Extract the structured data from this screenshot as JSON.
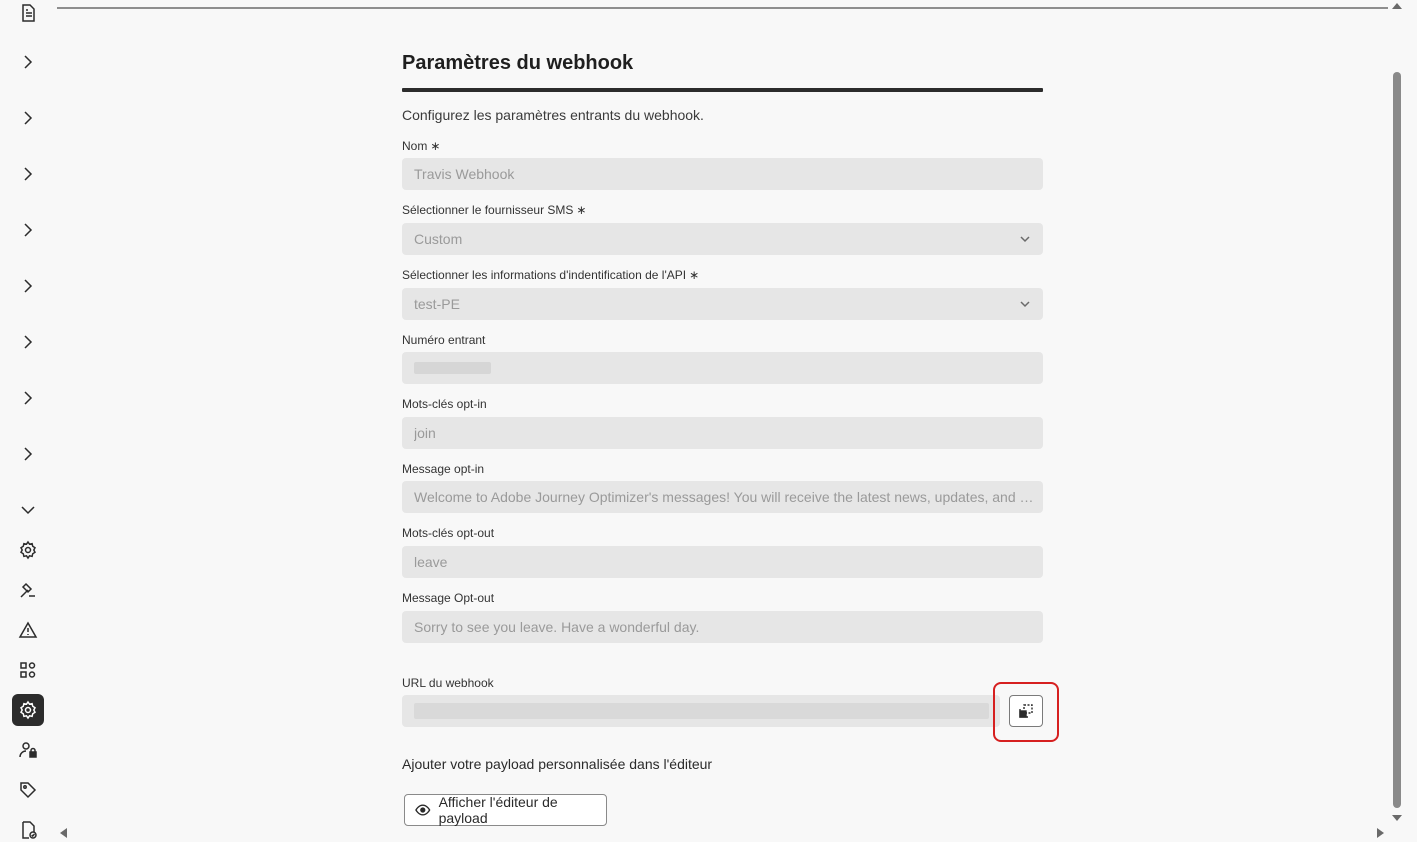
{
  "form": {
    "title": "Paramètres du webhook",
    "description": "Configurez les paramètres entrants du webhook.",
    "name_label": "Nom",
    "name_value": "Travis Webhook",
    "provider_label": "Sélectionner le fournisseur SMS",
    "provider_value": "Custom",
    "credentials_label": "Sélectionner les informations d'indentification de l'API",
    "credentials_value": "test-PE",
    "inbound_number_label": "Numéro entrant",
    "optin_keywords_label": "Mots-clés opt-in",
    "optin_keywords_value": "join",
    "optin_message_label": "Message opt-in",
    "optin_message_value": "Welcome to Adobe Journey Optimizer's messages! You will receive the latest news, updates, and informati...",
    "optout_keywords_label": "Mots-clés opt-out",
    "optout_keywords_value": "leave",
    "optout_message_label": "Message Opt-out",
    "optout_message_value": "Sorry to see you leave. Have a wonderful day.",
    "webhook_url_label": "URL du webhook",
    "payload_text": "Ajouter votre payload personnalisée dans l'éditeur",
    "payload_button": "Afficher l'éditeur de payload",
    "required_mark": "∗"
  },
  "rail": {
    "icons": [
      "document-icon",
      "chevron-right-icon",
      "chevron-down-icon",
      "gear-icon",
      "hammer-icon",
      "alert-icon",
      "workflow-icon",
      "settings-icon",
      "user-lock-icon",
      "tag-icon",
      "file-check-icon"
    ]
  }
}
